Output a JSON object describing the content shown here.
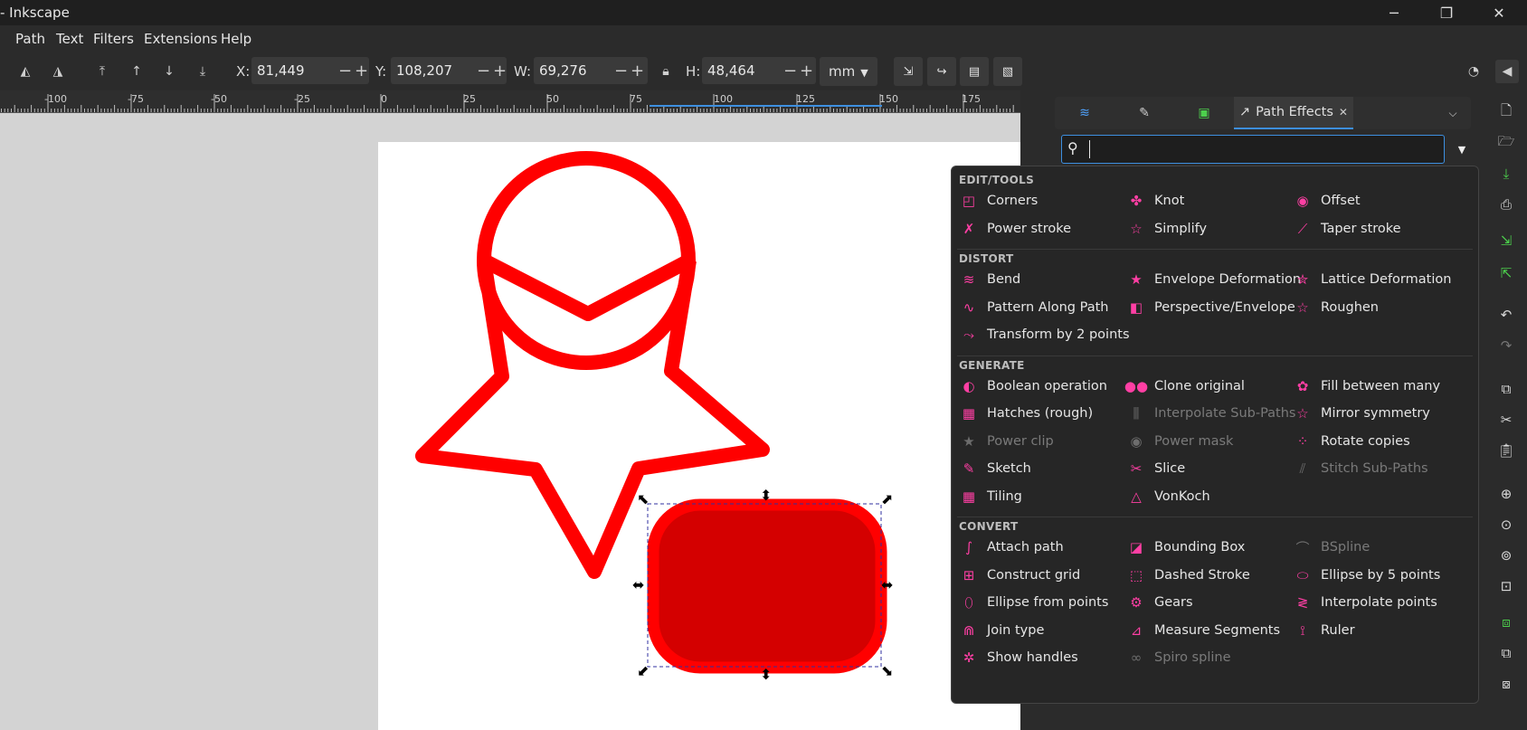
{
  "window": {
    "title": "- Inkscape",
    "minimize_glyph": "─",
    "maximize_glyph": "❐",
    "close_glyph": "✕"
  },
  "menu": [
    "Path",
    "Text",
    "Filters",
    "Extensions",
    "Help"
  ],
  "toolbar": {
    "x_label": "X:",
    "x_value": "81,449",
    "y_label": "Y:",
    "y_value": "108,207",
    "w_label": "W:",
    "w_value": "69,276",
    "h_label": "H:",
    "h_value": "48,464",
    "minus": "−",
    "plus": "+",
    "unit": "mm"
  },
  "ruler_labels": [
    "-100",
    "-75",
    "-50",
    "-25",
    "0",
    "25",
    "50",
    "75",
    "100",
    "125",
    "150",
    "175"
  ],
  "panel": {
    "active_tab": "Path Effects",
    "tab_close": "✕",
    "search_value": ""
  },
  "popup": {
    "categories": [
      {
        "name": "EDIT/TOOLS",
        "items": [
          {
            "label": "Corners",
            "icon": "corners-icon",
            "glyph": "◰",
            "disabled": false
          },
          {
            "label": "Knot",
            "icon": "knot-icon",
            "glyph": "✤",
            "disabled": false
          },
          {
            "label": "Offset",
            "icon": "offset-icon",
            "glyph": "◉",
            "disabled": false
          },
          {
            "label": "Power stroke",
            "icon": "power-stroke-icon",
            "glyph": "✗",
            "disabled": false
          },
          {
            "label": "Simplify",
            "icon": "simplify-icon",
            "glyph": "☆",
            "disabled": false
          },
          {
            "label": "Taper stroke",
            "icon": "taper-stroke-icon",
            "glyph": "⟋",
            "disabled": false
          }
        ]
      },
      {
        "name": "DISTORT",
        "items": [
          {
            "label": "Bend",
            "icon": "bend-icon",
            "glyph": "≋",
            "disabled": false
          },
          {
            "label": "Envelope Deformation",
            "icon": "envelope-deformation-icon",
            "glyph": "★",
            "disabled": false
          },
          {
            "label": "Lattice Deformation",
            "icon": "lattice-deformation-icon",
            "glyph": "✮",
            "disabled": false
          },
          {
            "label": "Pattern Along Path",
            "icon": "pattern-along-path-icon",
            "glyph": "∿",
            "disabled": false
          },
          {
            "label": "Perspective/Envelope",
            "icon": "perspective-envelope-icon",
            "glyph": "◧",
            "disabled": false
          },
          {
            "label": "Roughen",
            "icon": "roughen-icon",
            "glyph": "☆",
            "disabled": false
          },
          {
            "label": "Transform by 2 points",
            "icon": "transform-2-points-icon",
            "glyph": "⤳",
            "disabled": false
          }
        ]
      },
      {
        "name": "GENERATE",
        "items": [
          {
            "label": "Boolean operation",
            "icon": "boolean-operation-icon",
            "glyph": "◐",
            "disabled": false
          },
          {
            "label": "Clone original",
            "icon": "clone-original-icon",
            "glyph": "●●",
            "disabled": false
          },
          {
            "label": "Fill between many",
            "icon": "fill-between-many-icon",
            "glyph": "✿",
            "disabled": false
          },
          {
            "label": "Hatches (rough)",
            "icon": "hatches-icon",
            "glyph": "▦",
            "disabled": false
          },
          {
            "label": "Interpolate Sub-Paths",
            "icon": "interpolate-subpaths-icon",
            "glyph": "⫼",
            "disabled": true
          },
          {
            "label": "Mirror symmetry",
            "icon": "mirror-symmetry-icon",
            "glyph": "☆",
            "disabled": false
          },
          {
            "label": "Power clip",
            "icon": "power-clip-icon",
            "glyph": "★",
            "disabled": true
          },
          {
            "label": "Power mask",
            "icon": "power-mask-icon",
            "glyph": "◉",
            "disabled": true
          },
          {
            "label": "Rotate copies",
            "icon": "rotate-copies-icon",
            "glyph": "⁘",
            "disabled": false
          },
          {
            "label": "Sketch",
            "icon": "sketch-icon",
            "glyph": "✎",
            "disabled": false
          },
          {
            "label": "Slice",
            "icon": "slice-icon",
            "glyph": "✂",
            "disabled": false
          },
          {
            "label": "Stitch Sub-Paths",
            "icon": "stitch-subpaths-icon",
            "glyph": "⫽",
            "disabled": true
          },
          {
            "label": "Tiling",
            "icon": "tiling-icon",
            "glyph": "▦",
            "disabled": false
          },
          {
            "label": "VonKoch",
            "icon": "vonkoch-icon",
            "glyph": "△",
            "disabled": false
          }
        ]
      },
      {
        "name": "CONVERT",
        "items": [
          {
            "label": "Attach path",
            "icon": "attach-path-icon",
            "glyph": "∫",
            "disabled": false
          },
          {
            "label": "Bounding Box",
            "icon": "bounding-box-icon",
            "glyph": "◪",
            "disabled": false
          },
          {
            "label": "BSpline",
            "icon": "bspline-icon",
            "glyph": "⌒",
            "disabled": true
          },
          {
            "label": "Construct grid",
            "icon": "construct-grid-icon",
            "glyph": "⊞",
            "disabled": false
          },
          {
            "label": "Dashed Stroke",
            "icon": "dashed-stroke-icon",
            "glyph": "⬚",
            "disabled": false
          },
          {
            "label": "Ellipse by 5 points",
            "icon": "ellipse-5-points-icon",
            "glyph": "⬭",
            "disabled": false
          },
          {
            "label": "Ellipse from points",
            "icon": "ellipse-from-points-icon",
            "glyph": "⬯",
            "disabled": false
          },
          {
            "label": "Gears",
            "icon": "gears-icon",
            "glyph": "⚙",
            "disabled": false
          },
          {
            "label": "Interpolate points",
            "icon": "interpolate-points-icon",
            "glyph": "≷",
            "disabled": false
          },
          {
            "label": "Join type",
            "icon": "join-type-icon",
            "glyph": "⋒",
            "disabled": false
          },
          {
            "label": "Measure Segments",
            "icon": "measure-segments-icon",
            "glyph": "⊿",
            "disabled": false
          },
          {
            "label": "Ruler",
            "icon": "ruler-icon",
            "glyph": "⟟",
            "disabled": false
          },
          {
            "label": "Show handles",
            "icon": "show-handles-icon",
            "glyph": "✲",
            "disabled": false
          },
          {
            "label": "Spiro spline",
            "icon": "spiro-spline-icon",
            "glyph": "∞",
            "disabled": true
          }
        ]
      }
    ]
  },
  "colors": {
    "shape_stroke": "#ff0000",
    "rect_fill": "#d40000",
    "accent": "#3d8fe0",
    "lpe_icon": "#ff3fa4"
  }
}
